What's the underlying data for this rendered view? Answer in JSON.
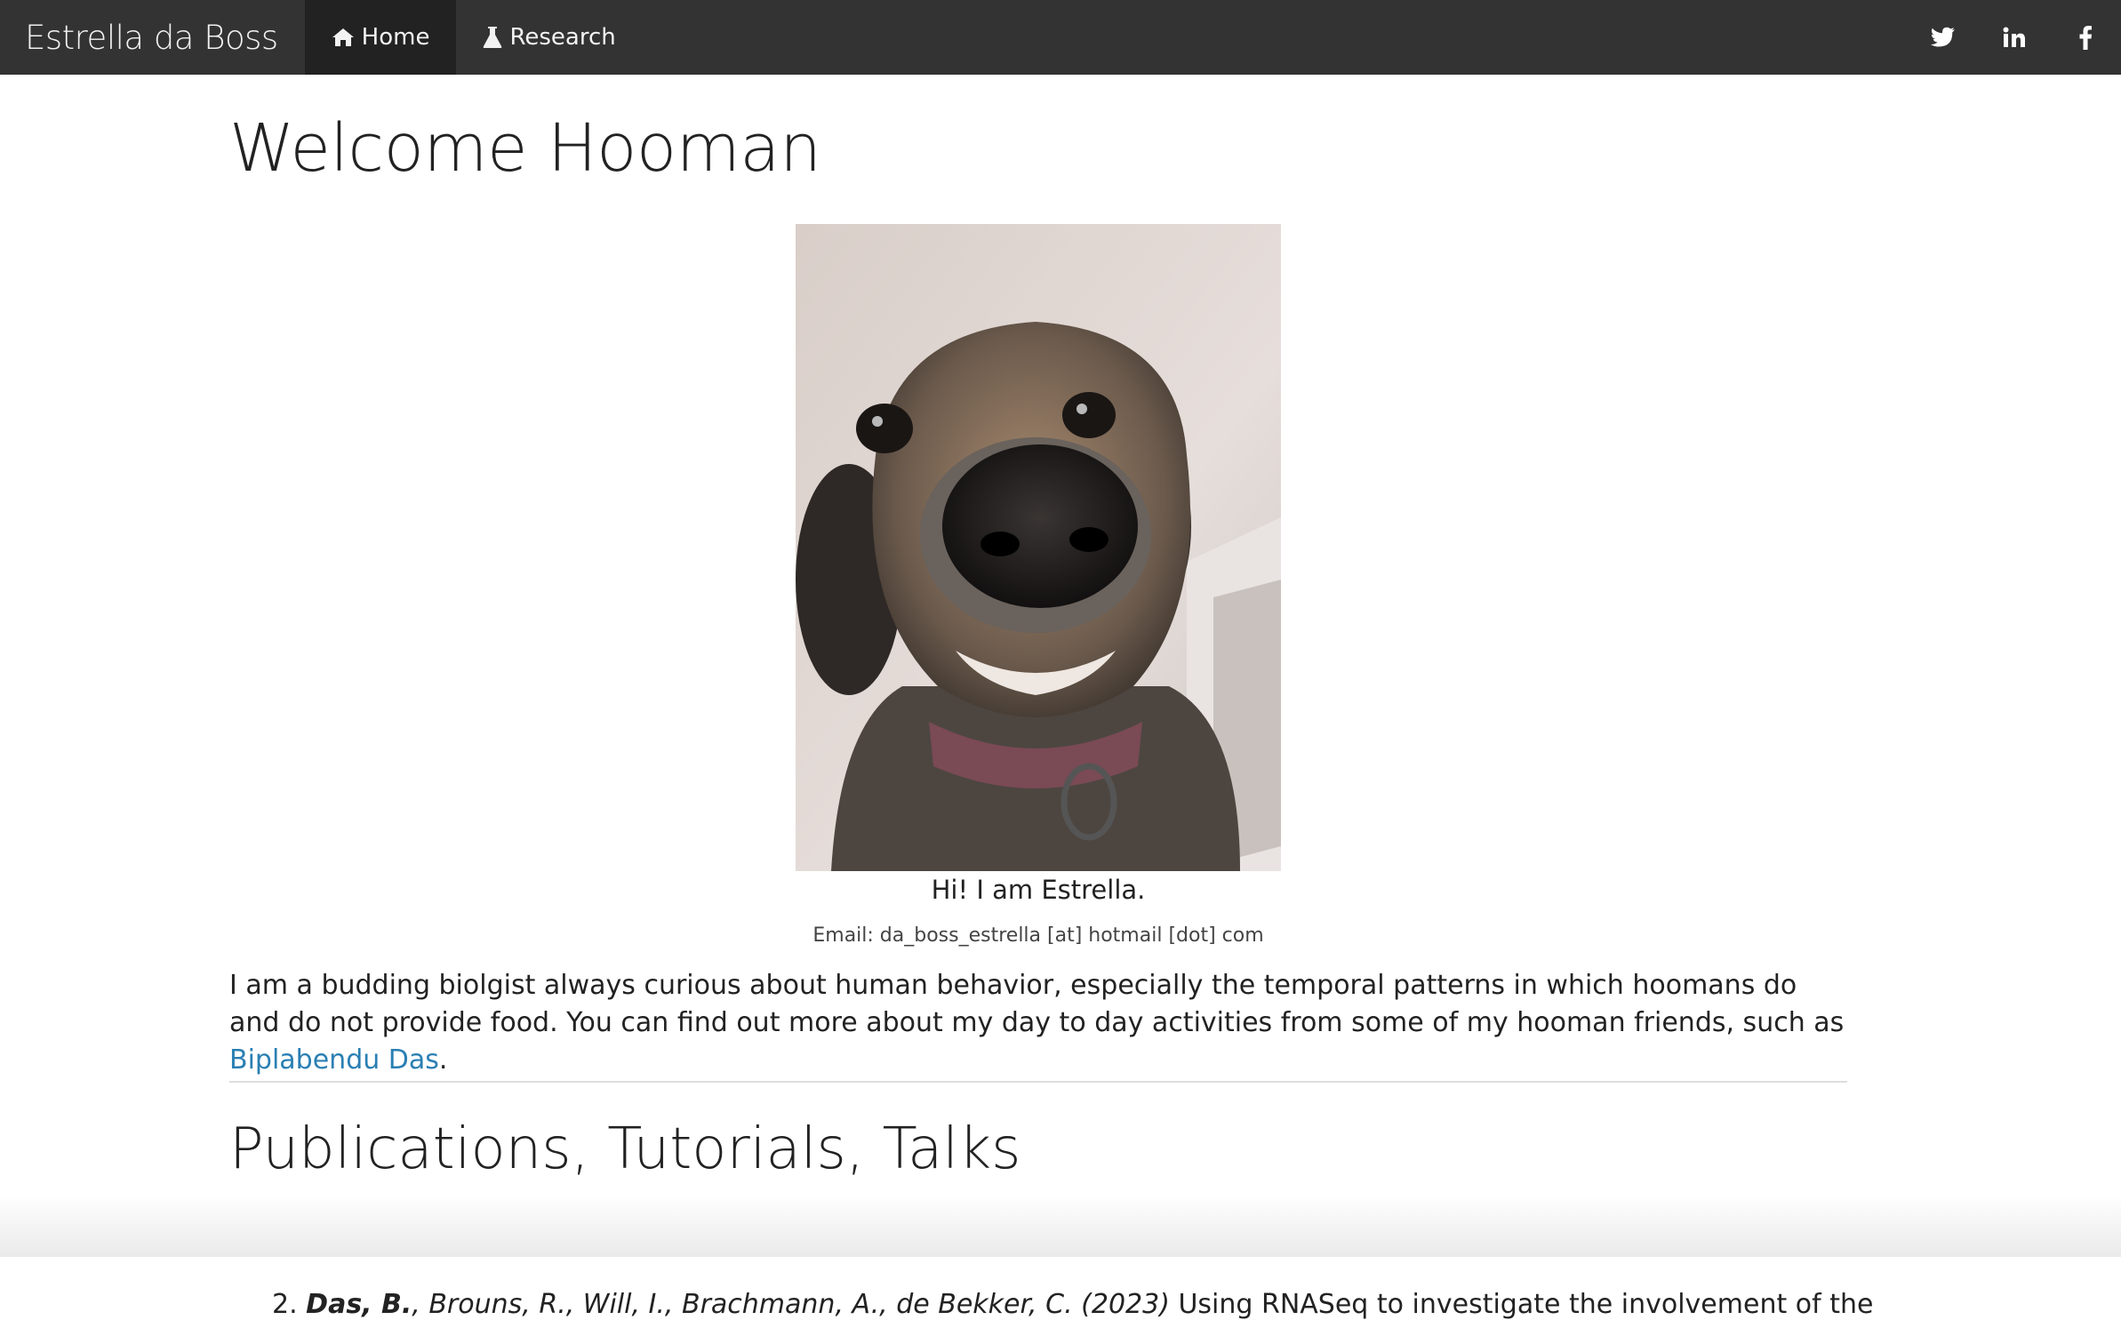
{
  "navbar": {
    "brand": "Estrella da Boss",
    "items": [
      {
        "label": "Home",
        "icon": "home-icon",
        "active": true
      },
      {
        "label": "Research",
        "icon": "flask-icon",
        "active": false
      }
    ],
    "social": [
      "twitter-icon",
      "linkedin-icon",
      "facebook-icon"
    ],
    "background": "#333333"
  },
  "main": {
    "title": "Welcome Hooman",
    "caption": "Hi! I am Estrella.",
    "email": "Email: da_boss_estrella [at] hotmail [dot] com",
    "bio_text": "I am a budding biolgist always curious about human behavior, especially the temporal patterns in which hoomans do and do not provide food. You can find out more about my day to day activities from some of my hooman friends, such as ",
    "bio_link": "Biplabendu Das",
    "bio_end": ".",
    "link_color": "#2a7fb3"
  },
  "publications": {
    "heading": "Publications, Tutorials, Talks",
    "items": [
      {
        "number": "2.",
        "author_bold": "Das, B.",
        "authors_rest": ", Brouns, R., Will, I., Brachmann, A., de Bekker, C. (2023)",
        "title": " Using RNASeq to investigate the involvement of the"
      }
    ]
  }
}
